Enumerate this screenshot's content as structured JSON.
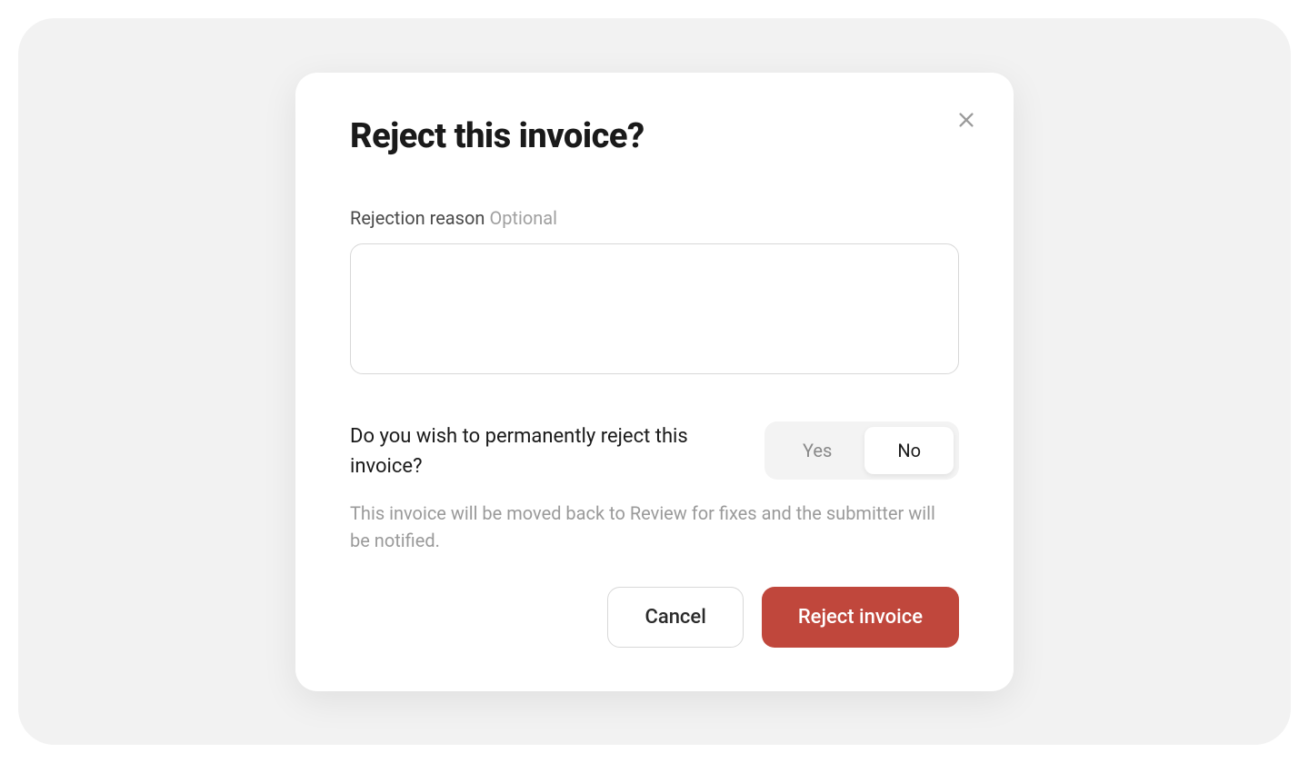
{
  "modal": {
    "title": "Reject this invoice?",
    "rejection_reason": {
      "label": "Rejection reason",
      "optional_label": "Optional",
      "value": ""
    },
    "permanent_question": "Do you wish to permanently reject this invoice?",
    "toggle": {
      "options": [
        "Yes",
        "No"
      ],
      "selected": "No"
    },
    "helper_text": "This invoice will be moved back to Review for fixes and the submitter will be notified.",
    "buttons": {
      "cancel": "Cancel",
      "reject": "Reject invoice"
    }
  }
}
